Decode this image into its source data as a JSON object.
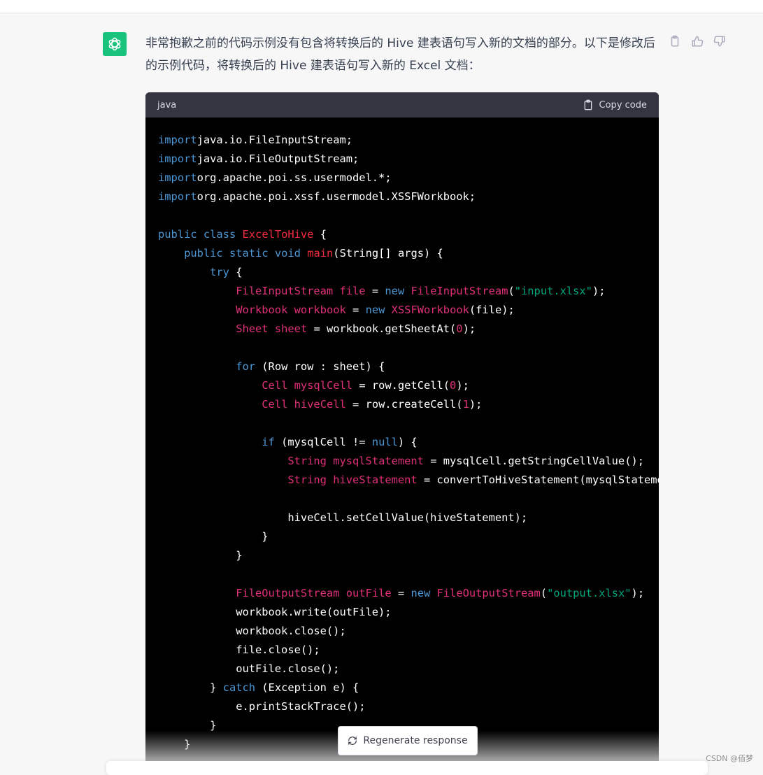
{
  "assistant": {
    "avatar_icon": "openai-logo-icon",
    "message": "非常抱歉之前的代码示例没有包含将转换后的 Hive 建表语句写入新的文档的部分。以下是修改后的示例代码，将转换后的 Hive 建表语句写入新的 Excel 文档："
  },
  "message_actions": {
    "icons": [
      "clipboard-icon",
      "thumbs-up-icon",
      "thumbs-down-icon"
    ]
  },
  "code_block": {
    "language": "java",
    "copy_label": "Copy code",
    "lines": [
      [
        [
          "kw",
          "import"
        ],
        [
          "",
          "java.io.FileInputStream;"
        ]
      ],
      [
        [
          "kw",
          "import"
        ],
        [
          "",
          "java.io.FileOutputStream;"
        ]
      ],
      [
        [
          "kw",
          "import"
        ],
        [
          "",
          "org.apache.poi.ss.usermodel.*;"
        ]
      ],
      [
        [
          "kw",
          "import"
        ],
        [
          "",
          "org.apache.poi.xssf.usermodel.XSSFWorkbook;"
        ]
      ],
      [],
      [
        [
          "kw",
          "public"
        ],
        [
          "",
          " "
        ],
        [
          "kw",
          "class"
        ],
        [
          "",
          " "
        ],
        [
          "fn",
          "ExcelToHive"
        ],
        [
          "",
          " {"
        ]
      ],
      [
        [
          "",
          "    "
        ],
        [
          "kw",
          "public"
        ],
        [
          "",
          " "
        ],
        [
          "kw",
          "static"
        ],
        [
          "",
          " "
        ],
        [
          "kw",
          "void"
        ],
        [
          "",
          " "
        ],
        [
          "fn",
          "main"
        ],
        [
          "",
          "(String[] args) {"
        ]
      ],
      [
        [
          "",
          "        "
        ],
        [
          "kw",
          "try"
        ],
        [
          "",
          " {"
        ]
      ],
      [
        [
          "",
          "            "
        ],
        [
          "ty",
          "FileInputStream"
        ],
        [
          "",
          " "
        ],
        [
          "ty",
          "file"
        ],
        [
          "",
          " = "
        ],
        [
          "kw",
          "new"
        ],
        [
          "",
          " "
        ],
        [
          "ty",
          "FileInputStream"
        ],
        [
          "",
          "("
        ],
        [
          "st",
          "\"input.xlsx\""
        ],
        [
          "",
          ");"
        ]
      ],
      [
        [
          "",
          "            "
        ],
        [
          "ty",
          "Workbook"
        ],
        [
          "",
          " "
        ],
        [
          "ty",
          "workbook"
        ],
        [
          "",
          " = "
        ],
        [
          "kw",
          "new"
        ],
        [
          "",
          " "
        ],
        [
          "ty",
          "XSSFWorkbook"
        ],
        [
          "",
          "(file);"
        ]
      ],
      [
        [
          "",
          "            "
        ],
        [
          "ty",
          "Sheet"
        ],
        [
          "",
          " "
        ],
        [
          "ty",
          "sheet"
        ],
        [
          "",
          " = workbook.getSheetAt("
        ],
        [
          "nu",
          "0"
        ],
        [
          "",
          ");"
        ]
      ],
      [],
      [
        [
          "",
          "            "
        ],
        [
          "kw",
          "for"
        ],
        [
          "",
          " (Row row : sheet) {"
        ]
      ],
      [
        [
          "",
          "                "
        ],
        [
          "ty",
          "Cell"
        ],
        [
          "",
          " "
        ],
        [
          "ty",
          "mysqlCell"
        ],
        [
          "",
          " = row.getCell("
        ],
        [
          "nu",
          "0"
        ],
        [
          "",
          ");"
        ]
      ],
      [
        [
          "",
          "                "
        ],
        [
          "ty",
          "Cell"
        ],
        [
          "",
          " "
        ],
        [
          "ty",
          "hiveCell"
        ],
        [
          "",
          " = row.createCell("
        ],
        [
          "nu",
          "1"
        ],
        [
          "",
          ");"
        ]
      ],
      [],
      [
        [
          "",
          "                "
        ],
        [
          "kw",
          "if"
        ],
        [
          "",
          " (mysqlCell != "
        ],
        [
          "kw",
          "null"
        ],
        [
          "",
          ") {"
        ]
      ],
      [
        [
          "",
          "                    "
        ],
        [
          "ty",
          "String"
        ],
        [
          "",
          " "
        ],
        [
          "ty",
          "mysqlStatement"
        ],
        [
          "",
          " = mysqlCell.getStringCellValue();"
        ]
      ],
      [
        [
          "",
          "                    "
        ],
        [
          "ty",
          "String"
        ],
        [
          "",
          " "
        ],
        [
          "ty",
          "hiveStatement"
        ],
        [
          "",
          " = convertToHiveStatement(mysqlStatement);"
        ]
      ],
      [],
      [
        [
          "",
          "                    hiveCell.setCellValue(hiveStatement);"
        ]
      ],
      [
        [
          "",
          "                }"
        ]
      ],
      [
        [
          "",
          "            }"
        ]
      ],
      [],
      [
        [
          "",
          "            "
        ],
        [
          "ty",
          "FileOutputStream"
        ],
        [
          "",
          " "
        ],
        [
          "ty",
          "outFile"
        ],
        [
          "",
          " = "
        ],
        [
          "kw",
          "new"
        ],
        [
          "",
          " "
        ],
        [
          "ty",
          "FileOutputStream"
        ],
        [
          "",
          "("
        ],
        [
          "st",
          "\"output.xlsx\""
        ],
        [
          "",
          ");"
        ]
      ],
      [
        [
          "",
          "            workbook.write(outFile);"
        ]
      ],
      [
        [
          "",
          "            workbook.close();"
        ]
      ],
      [
        [
          "",
          "            file.close();"
        ]
      ],
      [
        [
          "",
          "            outFile.close();"
        ]
      ],
      [
        [
          "",
          "        } "
        ],
        [
          "kw",
          "catch"
        ],
        [
          "",
          " (Exception e) {"
        ]
      ],
      [
        [
          "",
          "            e.printStackTrace();"
        ]
      ],
      [
        [
          "",
          "        }"
        ]
      ],
      [
        [
          "",
          "    }"
        ]
      ]
    ]
  },
  "regenerate_button": {
    "label": "Regenerate response",
    "icon": "refresh-icon"
  },
  "watermark": "CSDN @佰梦"
}
